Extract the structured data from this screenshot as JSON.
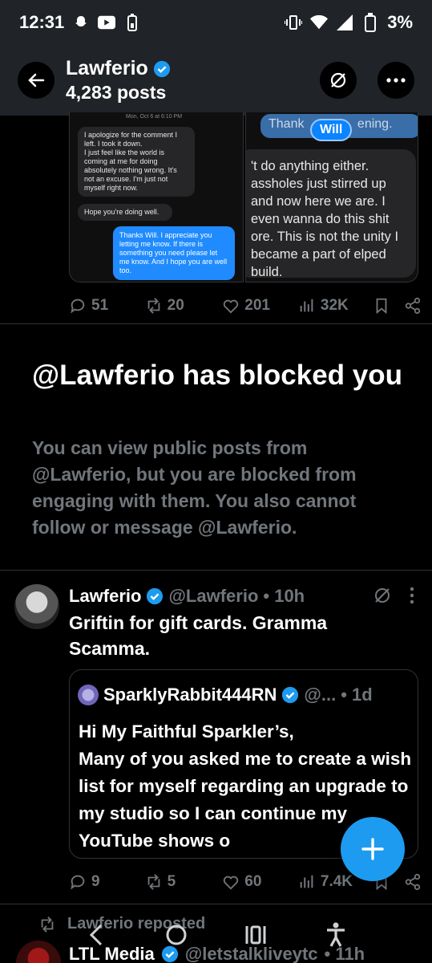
{
  "status_bar": {
    "time": "12:31",
    "battery": "3%",
    "icons": [
      "snapchat-icon",
      "youtube-icon",
      "battery-saver-icon",
      "vibrate-icon",
      "wifi-icon",
      "signal-icon",
      "battery-icon"
    ]
  },
  "header": {
    "name": "Lawferio",
    "posts": "4,283 posts",
    "icons": [
      "back-arrow-icon",
      "grok-icon",
      "more-icon"
    ]
  },
  "top_post": {
    "image_left": {
      "date": "Mon, Oct 6 at 6:10 PM",
      "msg1": "I apologize for the comment I left. I took it down.\nI just feel like the world is coming at me for doing absolutely nothing wrong. It's not an excuse. I'm just not myself right now.",
      "msg2": "Hope you're doing well.",
      "msg3": "Thanks Will. I appreciate you letting me know. If there is something you need please let me know. And I hope you are well too."
    },
    "image_right": {
      "blue_text": "Thank",
      "blue_text_end": "ening.",
      "tag": "Will",
      "gray_text": "'t do anything either. assholes just stirred up and now here we are. I even wanna do this shit ore. This is not the unity I became a part of elped build."
    },
    "actions": {
      "replies": "51",
      "reposts": "20",
      "likes": "201",
      "views": "32K"
    }
  },
  "blocked": {
    "title": "@Lawferio has blocked you",
    "body": "You can view public posts from @Lawferio, but you are blocked from engaging with them. You also cannot follow or message @Lawferio."
  },
  "tweet": {
    "name": "Lawferio",
    "handle": "@Lawferio",
    "time": "• 10h",
    "text": "Griftin for gift cards. Gramma Scamma.",
    "quote": {
      "name": "SparklyRabbit444RN",
      "handle": "@...",
      "time": "• 1d",
      "text": "Hi My Faithful Sparkler’s,\nMany of you asked me to create a wish list for myself regarding an upgrade to my studio so I can continue my YouTube shows o"
    },
    "actions": {
      "replies": "9",
      "reposts": "5",
      "likes": "60",
      "views": "7.4K"
    }
  },
  "next": {
    "repost_label": "Lawferio reposted",
    "name": "LTL Media",
    "handle": "@letstalkliveytc",
    "time": "• 11h"
  },
  "colors": {
    "accent": "#1d9bf0",
    "muted": "#71767b",
    "background": "#000000",
    "header": "#202327"
  }
}
